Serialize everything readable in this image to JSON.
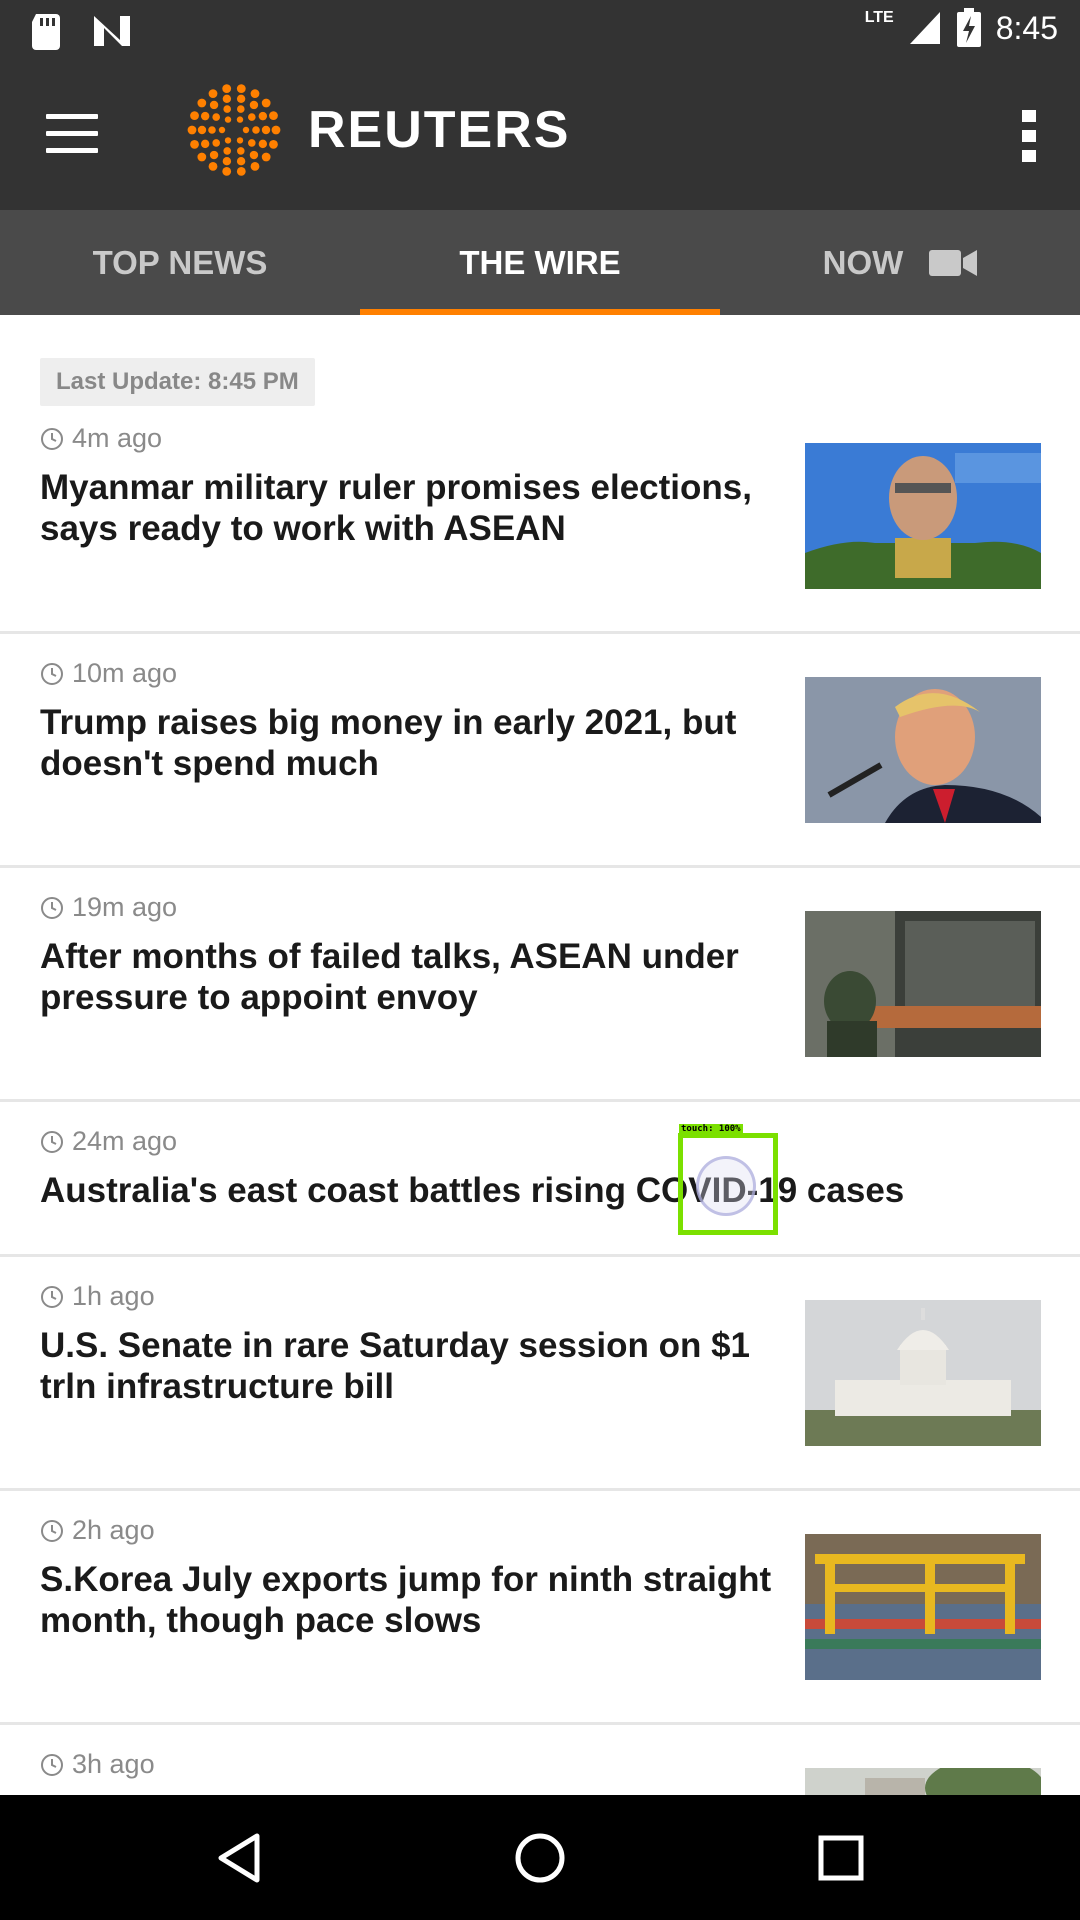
{
  "status_bar": {
    "network": "LTE",
    "time": "8:45"
  },
  "header": {
    "brand": "REUTERS",
    "accent_color": "#ff8000"
  },
  "tabs": [
    {
      "label": "TOP NEWS",
      "active": false
    },
    {
      "label": "THE WIRE",
      "active": true
    },
    {
      "label": "NOW",
      "active": false,
      "icon": "video-camera-icon"
    }
  ],
  "feed": {
    "last_update": "Last Update: 8:45 PM",
    "articles": [
      {
        "time": "4m ago",
        "title": "Myanmar military ruler promises elections, says ready to work with ASEAN",
        "thumbnail": "general-portrait"
      },
      {
        "time": "10m ago",
        "title": "Trump raises big money in early 2021, but doesn't spend much",
        "thumbnail": "speaker-portrait"
      },
      {
        "time": "19m ago",
        "title": "After months of failed talks, ASEAN under pressure to appoint envoy",
        "thumbnail": "soldiers-street"
      },
      {
        "time": "24m ago",
        "title": "Australia's east coast battles rising COVID-19 cases",
        "thumbnail": ""
      },
      {
        "time": "1h ago",
        "title": "U.S. Senate in rare Saturday session on $1 trln infrastructure bill",
        "thumbnail": "capitol-building"
      },
      {
        "time": "2h ago",
        "title": "S.Korea July exports jump for ninth straight month, though pace slows",
        "thumbnail": "container-port"
      },
      {
        "time": "3h ago",
        "title": "",
        "thumbnail": "trees-building"
      }
    ]
  },
  "touch_indicator": {
    "label": "touch: 100%"
  },
  "nav_bar": {
    "back": "back-icon",
    "home": "home-icon",
    "recents": "recents-icon"
  }
}
